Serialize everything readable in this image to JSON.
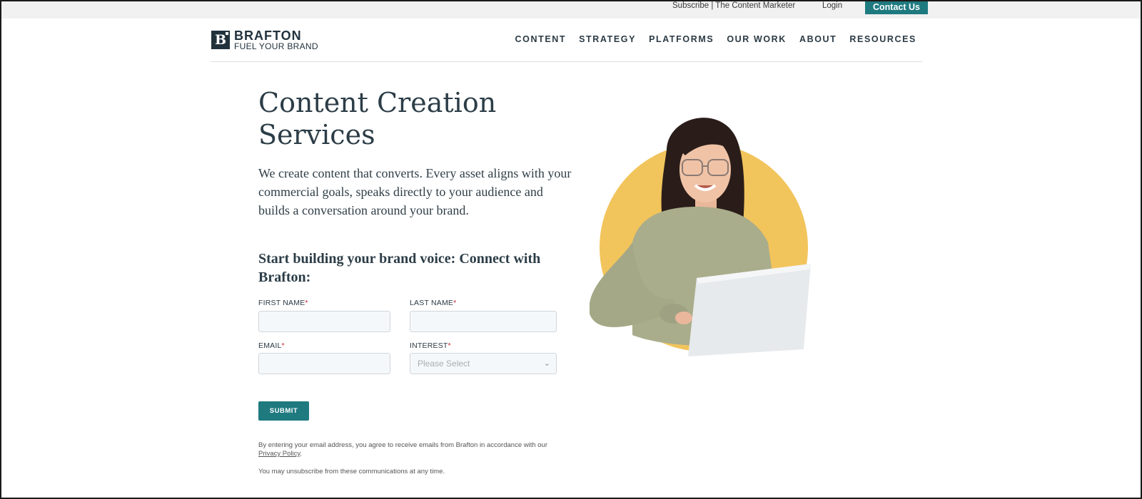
{
  "topbar": {
    "subscribe": "Subscribe | The Content Marketer",
    "login": "Login",
    "contact": "Contact Us"
  },
  "logo": {
    "mark": "B",
    "name": "BRAFTON",
    "tagline": "FUEL YOUR BRAND"
  },
  "nav": {
    "items": [
      "CONTENT",
      "STRATEGY",
      "PLATFORMS",
      "OUR WORK",
      "ABOUT",
      "RESOURCES"
    ]
  },
  "hero": {
    "title": "Content Creation Services",
    "description": "We create content that converts. Every asset aligns with your commercial goals, speaks directly to your audience and builds a conversation around your brand."
  },
  "form": {
    "heading": "Start building your brand voice: Connect with Brafton:",
    "first_name_label": "FIRST NAME",
    "last_name_label": "LAST NAME",
    "email_label": "EMAIL",
    "interest_label": "INTEREST",
    "required_marker": "*",
    "interest_placeholder": "Please Select",
    "submit_label": "SUBMIT"
  },
  "legal": {
    "consent_prefix": "By entering your email address, you agree to receive emails from Brafton in accordance with our",
    "privacy_link": "Privacy Policy",
    "consent_suffix": ".",
    "unsubscribe": "You may unsubscribe from these communications at any time."
  },
  "colors": {
    "accent": "#1f7a80",
    "text_dark": "#2c3d47",
    "circle": "#f2c45c",
    "required": "#c0262d"
  }
}
